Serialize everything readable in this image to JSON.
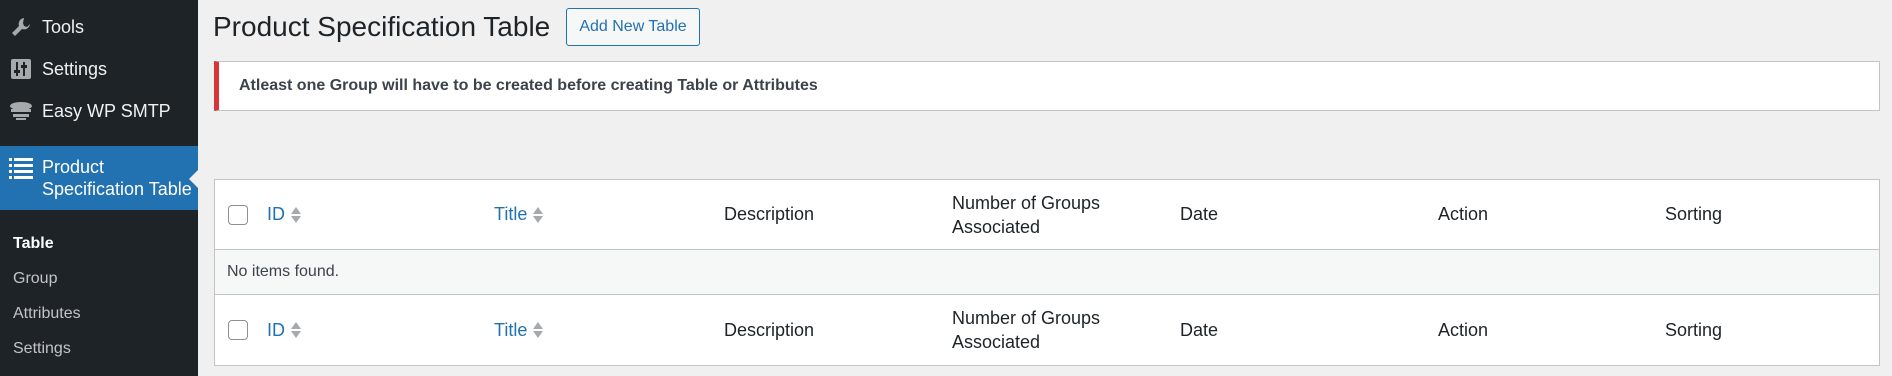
{
  "sidebar": {
    "items": [
      {
        "label": "Tools",
        "icon": "wrench-icon"
      },
      {
        "label": "Settings",
        "icon": "settings-sliders-icon"
      },
      {
        "label": "Easy WP SMTP",
        "icon": "smtp-icon"
      },
      {
        "label_line1": "Product",
        "label_line2": "Specification Table",
        "icon": "list-icon"
      }
    ],
    "submenu": [
      "Table",
      "Group",
      "Attributes",
      "Settings"
    ]
  },
  "header": {
    "title": "Product Specification Table",
    "add_button": "Add New Table"
  },
  "notice": {
    "text": "Atleast one Group will have to be created before creating Table or Attributes",
    "color": "#d63638"
  },
  "table": {
    "columns": {
      "id": "ID",
      "title": "Title",
      "description": "Description",
      "groups_line1": "Number of Groups",
      "groups_line2": "Associated",
      "date": "Date",
      "action": "Action",
      "sorting": "Sorting"
    },
    "empty_text": "No items found."
  },
  "colors": {
    "accent": "#2271b1",
    "sidebar_bg": "#1d2327"
  }
}
